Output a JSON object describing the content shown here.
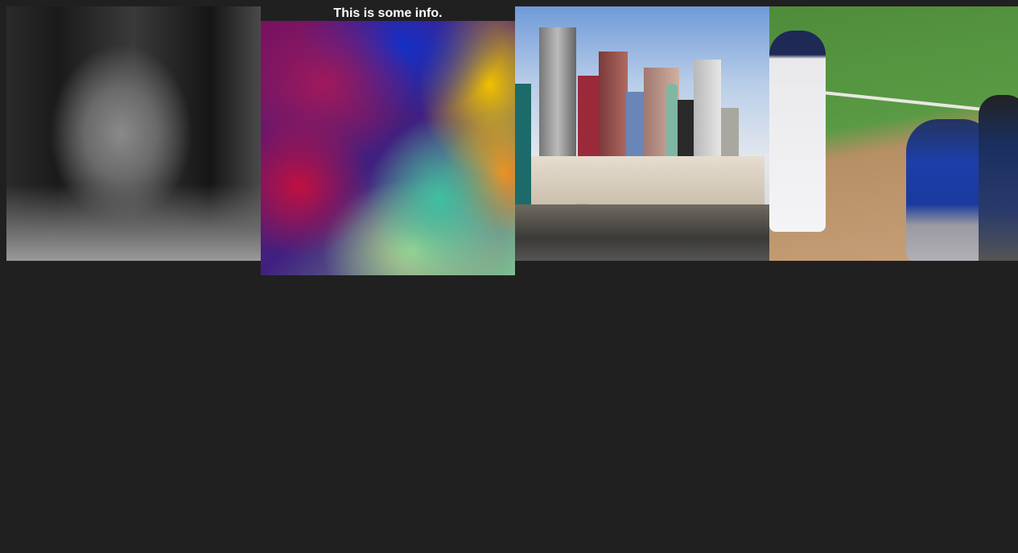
{
  "gallery": {
    "tiles": [
      {
        "alt": "Black and white portrait of an elderly man in a cap"
      },
      {
        "alt": "Colorful abstract blur",
        "caption": "This is some info."
      },
      {
        "alt": "Las Vegas skyline with Statue of Liberty replica"
      },
      {
        "alt": "Baseball batter, catcher and umpire at home plate"
      }
    ]
  },
  "colors": {
    "background": "#202020",
    "caption_text": "#ffffff"
  }
}
